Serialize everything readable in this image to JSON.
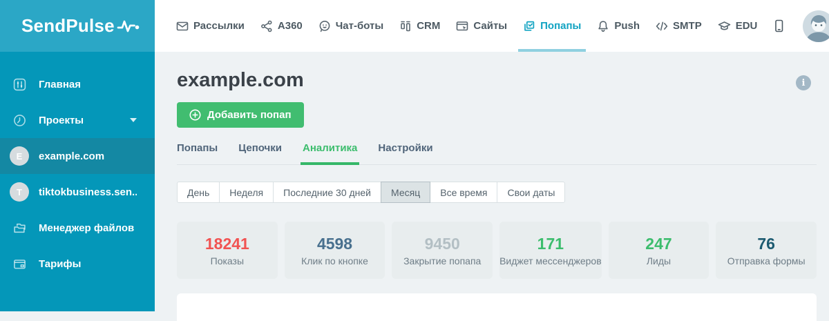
{
  "brand": {
    "name": "SendPulse"
  },
  "topnav": {
    "items": [
      {
        "label": "Рассылки",
        "icon": "envelope-icon",
        "active": false
      },
      {
        "label": "A360",
        "icon": "share-nodes-icon",
        "active": false
      },
      {
        "label": "Чат-боты",
        "icon": "chat-bot-icon",
        "active": false
      },
      {
        "label": "CRM",
        "icon": "kanban-icon",
        "active": false
      },
      {
        "label": "Сайты",
        "icon": "browser-icon",
        "active": false
      },
      {
        "label": "Попапы",
        "icon": "popups-icon",
        "active": true
      },
      {
        "label": "Push",
        "icon": "bell-icon",
        "active": false
      },
      {
        "label": "SMTP",
        "icon": "code-icon",
        "active": false
      },
      {
        "label": "EDU",
        "icon": "graduation-cap-icon",
        "active": false
      }
    ]
  },
  "sidebar": {
    "items": [
      {
        "label": "Главная",
        "icon": "sliders-icon"
      },
      {
        "label": "Проекты",
        "icon": "clock-icon",
        "has_caret": true
      },
      {
        "label": "example.com",
        "badge": "E",
        "selected": true
      },
      {
        "label": "tiktokbusiness.sen...",
        "badge": "T"
      },
      {
        "label": "Менеджер файлов",
        "icon": "folder-icon"
      },
      {
        "label": "Тарифы",
        "icon": "wallet-icon"
      }
    ]
  },
  "page": {
    "title": "example.com",
    "info_label": "i",
    "add_button_label": "Добавить попап",
    "tabs": [
      {
        "label": "Попапы",
        "active": false
      },
      {
        "label": "Цепочки",
        "active": false
      },
      {
        "label": "Аналитика",
        "active": true
      },
      {
        "label": "Настройки",
        "active": false
      }
    ],
    "date_filters": [
      {
        "label": "День",
        "selected": false
      },
      {
        "label": "Неделя",
        "selected": false
      },
      {
        "label": "Последние 30 дней",
        "selected": false
      },
      {
        "label": "Месяц",
        "selected": true
      },
      {
        "label": "Все время",
        "selected": false
      },
      {
        "label": "Свои даты",
        "selected": false
      }
    ],
    "stats": [
      {
        "value": "18241",
        "label": "Показы",
        "color": "#f15352"
      },
      {
        "value": "4598",
        "label": "Клик по кнопке",
        "color": "#48708e"
      },
      {
        "value": "9450",
        "label": "Закрытие попапа",
        "color": "#b3bfc4"
      },
      {
        "value": "171",
        "label": "Виджет мессенджеров",
        "color": "#3cbd6d"
      },
      {
        "value": "247",
        "label": "Лиды",
        "color": "#3cbd6d"
      },
      {
        "value": "76",
        "label": "Отправка формы",
        "color": "#1b5a70"
      }
    ]
  },
  "colors": {
    "sidebar_bg": "#0497b9",
    "sidebar_header_bg": "#2ba7c6",
    "nav_active": "#11a3c2",
    "accent_green": "#41bd70",
    "main_bg": "#eef2f4",
    "card_bg": "#e8edee"
  }
}
